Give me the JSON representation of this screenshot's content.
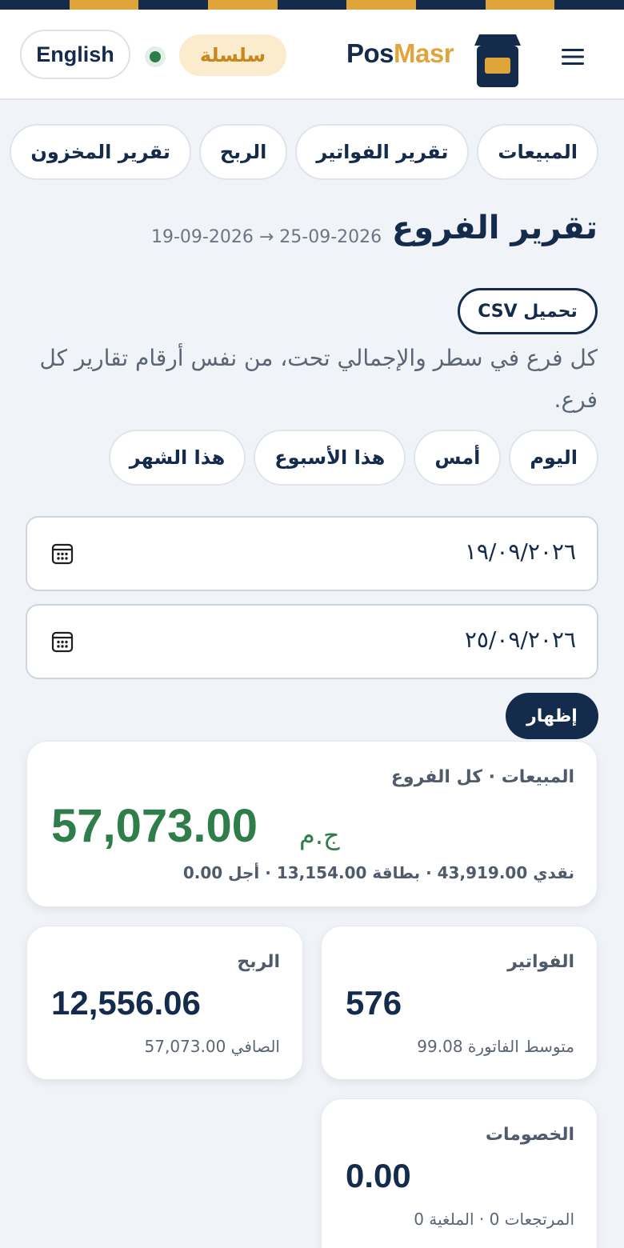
{
  "colors": {
    "navy": "#142b4c",
    "gold": "#e0a53a",
    "green": "#2f7d4a",
    "background": "#f0f3f7"
  },
  "header": {
    "language_button": "English",
    "status": "online",
    "plan_badge": "سلسلة",
    "brand_part1": "Pos",
    "brand_part2": "Masr",
    "logo_icon": "store-box-icon",
    "menu_icon": "hamburger-menu-icon"
  },
  "report_tabs": [
    "المبيعات",
    "تقرير الفواتير",
    "الربح",
    "تقرير المخزون"
  ],
  "page": {
    "title": "تقرير الفروع",
    "date_range": "19-09-2026 → 25-09-2026",
    "csv_button": "تحميل CSV",
    "description": "كل فرع في سطر والإجمالي تحت، من نفس أرقام تقارير كل فرع."
  },
  "presets": [
    "اليوم",
    "أمس",
    "هذا الأسبوع",
    "هذا الشهر"
  ],
  "filters": {
    "from_date": "١٩/٠٩/٢٠٢٦",
    "to_date": "٢٥/٠٩/٢٠٢٦",
    "calendar_icon": "calendar-icon",
    "show_button": "إظهار"
  },
  "summary": {
    "sales": {
      "label": "المبيعات · كل الفروع",
      "amount": "57,073.00",
      "currency": "ج.م",
      "breakdown": "نقدي 43,919.00 · بطاقة 13,154.00 · أجل 0.00"
    },
    "invoices": {
      "label": "الفواتير",
      "value": "576",
      "sub": "متوسط الفاتورة 99.08"
    },
    "profit": {
      "label": "الربح",
      "value": "12,556.06",
      "sub": "الصافي 57,073.00"
    },
    "discounts": {
      "label": "الخصومات",
      "value": "0.00",
      "sub": "المرتجعات 0 · الملغية 0"
    }
  }
}
